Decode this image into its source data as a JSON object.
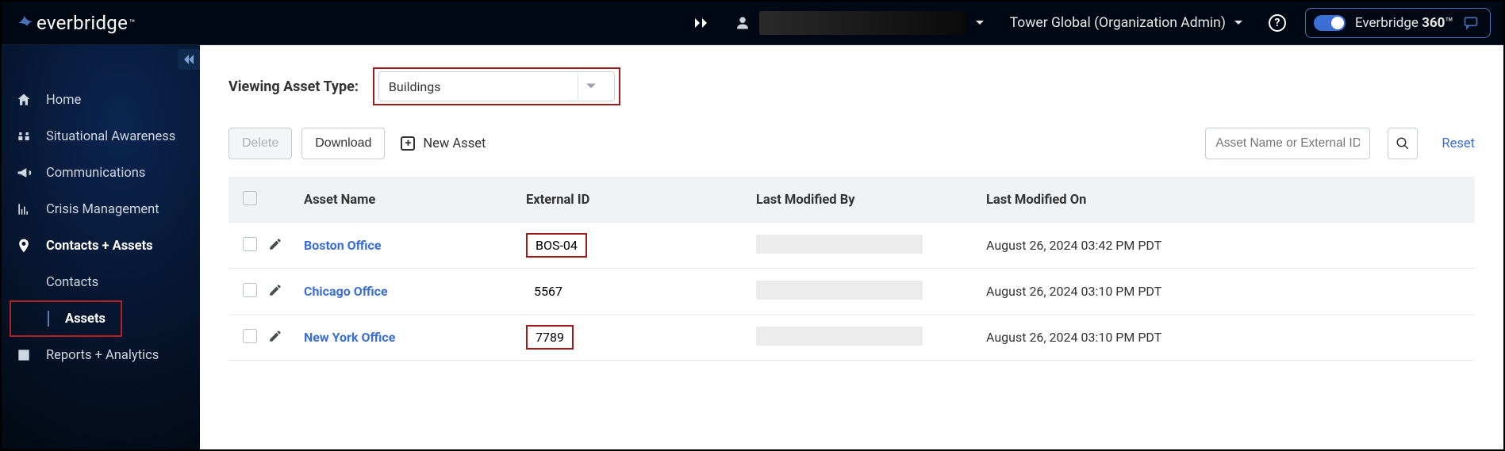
{
  "brand": {
    "name": "everbridge",
    "tm": "™"
  },
  "header": {
    "org_text": "Tower Global (Organization Admin)",
    "switch_prefix": "Everbridge ",
    "switch_bold": "360",
    "switch_suffix": "™"
  },
  "sidebar": {
    "items": [
      {
        "icon": "home-icon",
        "label": "Home"
      },
      {
        "icon": "binoculars-icon",
        "label": "Situational Awareness"
      },
      {
        "icon": "megaphone-icon",
        "label": "Communications"
      },
      {
        "icon": "chart-icon",
        "label": "Crisis Management"
      },
      {
        "icon": "pin-icon",
        "label": "Contacts + Assets"
      },
      {
        "icon": "report-icon",
        "label": "Reports + Analytics"
      }
    ],
    "sub": {
      "contacts": "Contacts",
      "assets": "Assets"
    }
  },
  "filter": {
    "label": "Viewing Asset Type:",
    "value": "Buildings"
  },
  "toolbar": {
    "delete": "Delete",
    "download": "Download",
    "new_asset": "New Asset",
    "search_placeholder": "Asset Name or External ID",
    "reset": "Reset"
  },
  "table": {
    "headers": {
      "asset_name": "Asset Name",
      "external_id": "External ID",
      "modified_by": "Last Modified By",
      "modified_on": "Last Modified On"
    },
    "rows": [
      {
        "name": "Boston Office",
        "ext": "BOS-04",
        "ext_highlight": true,
        "date": "August 26, 2024 03:42 PM PDT"
      },
      {
        "name": "Chicago Office",
        "ext": "5567",
        "ext_highlight": false,
        "date": "August 26, 2024 03:10 PM PDT"
      },
      {
        "name": "New York Office",
        "ext": "7789",
        "ext_highlight": true,
        "date": "August 26, 2024 03:10 PM PDT"
      }
    ]
  }
}
